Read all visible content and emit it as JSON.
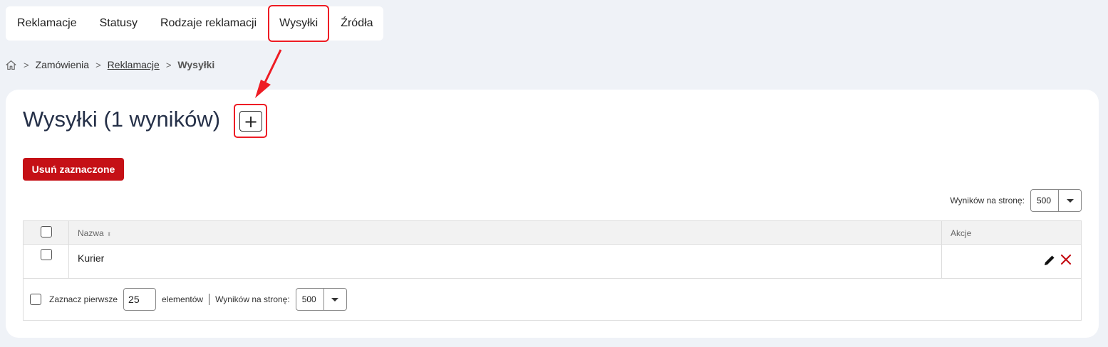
{
  "tabs": [
    {
      "label": "Reklamacje"
    },
    {
      "label": "Statusy"
    },
    {
      "label": "Rodzaje reklamacji"
    },
    {
      "label": "Wysyłki"
    },
    {
      "label": "Źródła"
    }
  ],
  "breadcrumb": {
    "items": [
      "Zamówienia",
      "Reklamacje",
      "Wysyłki"
    ]
  },
  "page": {
    "title": "Wysyłki (1 wyników)",
    "add_button": "+",
    "delete_button": "Usuń zaznaczone"
  },
  "pagination_top": {
    "label": "Wyników na stronę:",
    "value": "500"
  },
  "table": {
    "columns": [
      "Nazwa",
      "Akcje"
    ],
    "rows": [
      {
        "name": "Kurier"
      }
    ]
  },
  "footer": {
    "select_first_label": "Zaznacz pierwsze",
    "select_first_value": "25",
    "elements_label": "elementów",
    "per_page_label": "Wyników na stronę:",
    "per_page_value": "500"
  },
  "colors": {
    "accent_red": "#c51016",
    "annotation_red": "#ee1c24",
    "title": "#253048"
  },
  "icons": [
    "home-icon",
    "chevron-right-icon",
    "plus-icon",
    "pencil-icon",
    "close-icon",
    "caret-down-icon",
    "sort-icon"
  ]
}
